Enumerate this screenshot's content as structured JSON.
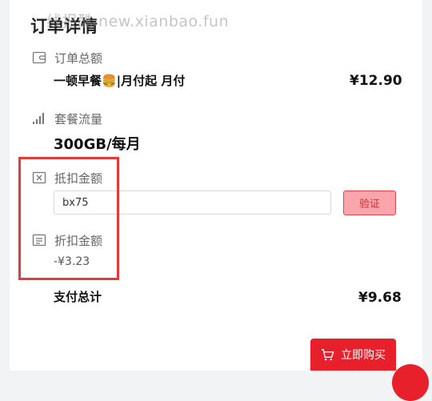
{
  "watermark": "线报酷 new.xianbao.fun",
  "page_title": "订单详情",
  "order_total": {
    "label": "订单总额",
    "product_name": "一顿早餐🍔|月付起 月付",
    "price": "¥12.90"
  },
  "package": {
    "label": "套餐流量",
    "value": "300GB/每月"
  },
  "deduction": {
    "label": "抵扣金额",
    "code_value": "bx75",
    "verify_label": "验证"
  },
  "discount": {
    "label": "折扣金额",
    "value": "-¥3.23"
  },
  "payment_total": {
    "label": "支付总计",
    "value": "¥9.68"
  },
  "buy_button_label": "立即购买",
  "colors": {
    "accent": "#e8202c",
    "highlight": "#e53a3a",
    "verify_bg": "#f9a5ab"
  },
  "icons": [
    "wallet-icon",
    "signal-icon",
    "coupon-icon",
    "list-icon",
    "cart-icon"
  ]
}
